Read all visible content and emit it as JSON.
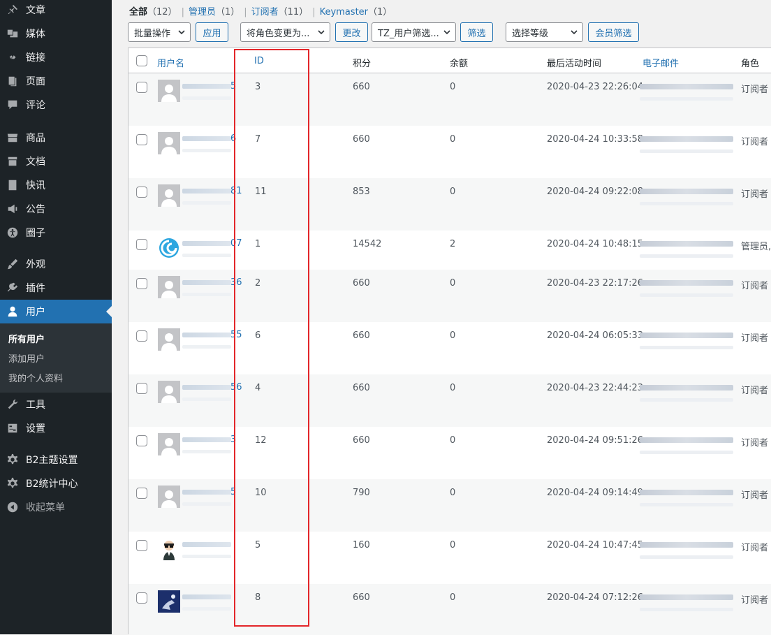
{
  "sidebar": {
    "items": [
      {
        "label": "文章",
        "icon": "pin-icon"
      },
      {
        "label": "媒体",
        "icon": "media-icon"
      },
      {
        "label": "链接",
        "icon": "link-icon"
      },
      {
        "label": "页面",
        "icon": "page-icon"
      },
      {
        "label": "评论",
        "icon": "comment-icon"
      },
      {
        "label": "商品",
        "icon": "store-icon"
      },
      {
        "label": "文档",
        "icon": "archive-icon"
      },
      {
        "label": "快讯",
        "icon": "news-icon"
      },
      {
        "label": "公告",
        "icon": "megaphone-icon"
      },
      {
        "label": "圈子",
        "icon": "universal-access-icon"
      },
      {
        "label": "外观",
        "icon": "brush-icon"
      },
      {
        "label": "插件",
        "icon": "plugin-icon"
      },
      {
        "label": "用户",
        "icon": "user-icon"
      },
      {
        "label": "工具",
        "icon": "wrench-icon"
      },
      {
        "label": "设置",
        "icon": "settings-icon"
      },
      {
        "label": "B2主题设置",
        "icon": "gear-icon"
      },
      {
        "label": "B2统计中心",
        "icon": "gear-icon"
      },
      {
        "label": "收起菜单",
        "icon": "collapse-icon"
      }
    ],
    "submenu": [
      "所有用户",
      "添加用户",
      "我的个人资料"
    ]
  },
  "filters": {
    "all": "全部",
    "all_count": "（12）",
    "admin": "管理员",
    "admin_count": "（1）",
    "subscriber": "订阅者",
    "subscriber_count": "（11）",
    "keymaster": "Keymaster",
    "keymaster_count": "（1）"
  },
  "toolbar": {
    "bulk": "批量操作",
    "apply": "应用",
    "role_change": "将角色变更为...",
    "change": "更改",
    "tz_filter": "TZ_用户筛选...",
    "filter": "筛选",
    "level": "选择等级",
    "member_filter": "会员筛选"
  },
  "columns": {
    "username": "用户名",
    "id": "ID",
    "points": "积分",
    "balance": "余额",
    "last_active": "最后活动时间",
    "email": "电子邮件",
    "role": "角色"
  },
  "rows": [
    {
      "name_tail": "5",
      "id": "3",
      "points": "660",
      "balance": "0",
      "last_active": "2020-04-23 22:26:04",
      "role": "订阅者",
      "avatar": "default"
    },
    {
      "name_tail": "6",
      "id": "7",
      "points": "660",
      "balance": "0",
      "last_active": "2020-04-24 10:33:58",
      "role": "订阅者",
      "avatar": "default"
    },
    {
      "name_tail": "81",
      "id": "11",
      "points": "853",
      "balance": "0",
      "last_active": "2020-04-24 09:22:08",
      "role": "订阅者",
      "avatar": "default"
    },
    {
      "name_tail": "07",
      "id": "1",
      "points": "14542",
      "balance": "2",
      "last_active": "2020-04-24 10:48:15",
      "role": "管理员,",
      "avatar": "swirl"
    },
    {
      "name_tail": "36",
      "id": "2",
      "points": "660",
      "balance": "0",
      "last_active": "2020-04-23 22:17:26",
      "role": "订阅者",
      "avatar": "default"
    },
    {
      "name_tail": "55",
      "id": "6",
      "points": "660",
      "balance": "0",
      "last_active": "2020-04-24 06:05:33",
      "role": "订阅者",
      "avatar": "default"
    },
    {
      "name_tail": "56",
      "id": "4",
      "points": "660",
      "balance": "0",
      "last_active": "2020-04-23 22:44:23",
      "role": "订阅者",
      "avatar": "default"
    },
    {
      "name_tail": "3",
      "id": "12",
      "points": "660",
      "balance": "0",
      "last_active": "2020-04-24 09:51:26",
      "role": "订阅者",
      "avatar": "default"
    },
    {
      "name_tail": "5",
      "id": "10",
      "points": "790",
      "balance": "0",
      "last_active": "2020-04-24 09:14:49",
      "role": "订阅者",
      "avatar": "default"
    },
    {
      "name_tail": "",
      "id": "5",
      "points": "160",
      "balance": "0",
      "last_active": "2020-04-24 10:47:45",
      "role": "订阅者",
      "avatar": "glasses"
    },
    {
      "name_tail": "",
      "id": "8",
      "points": "660",
      "balance": "0",
      "last_active": "2020-04-24 07:12:26",
      "role": "订阅者",
      "avatar": "photo"
    }
  ],
  "colors": {
    "sidebar": "#1d2327",
    "accent": "#2271b1",
    "highlight": "#e3262a"
  }
}
